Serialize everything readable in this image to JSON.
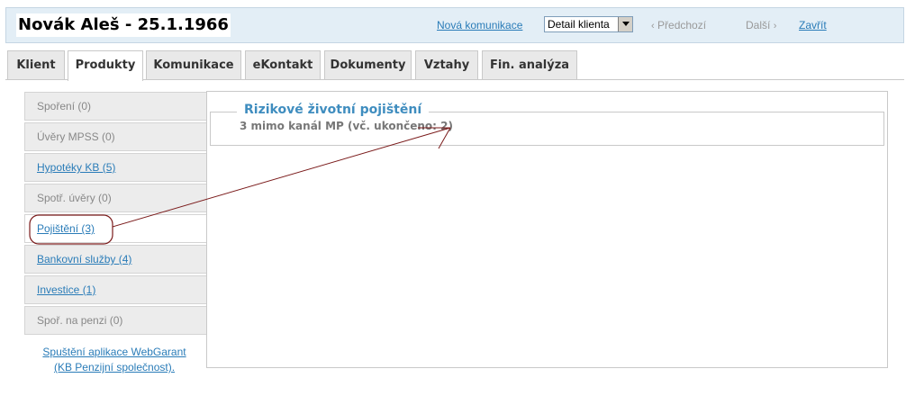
{
  "header": {
    "client_title": "Novák Aleš - 25.1.1966",
    "new_communication": "Nová komunikace",
    "detail_select": {
      "value": "Detail klienta"
    },
    "prev": "Předchozí",
    "next": "Další",
    "close": "Zavřít"
  },
  "tabs": [
    {
      "label": "Klient"
    },
    {
      "label": "Produkty"
    },
    {
      "label": "Komunikace"
    },
    {
      "label": "eKontakt"
    },
    {
      "label": "Dokumenty"
    },
    {
      "label": "Vztahy"
    },
    {
      "label": "Fin. analýza"
    }
  ],
  "active_tab": "Produkty",
  "sidebar": {
    "items": [
      {
        "label": "Spoření (0)",
        "link": false
      },
      {
        "label": "Úvěry MPSS (0)",
        "link": false
      },
      {
        "label": "Hypotéky KB (5)",
        "link": true
      },
      {
        "label": "Spotř. úvěry (0)",
        "link": false
      },
      {
        "label": "Pojištění (3)",
        "link": true,
        "active": true
      },
      {
        "label": "Bankovní služby (4)",
        "link": true
      },
      {
        "label": "Investice (1)",
        "link": true
      },
      {
        "label": "Spoř. na penzi (0)",
        "link": false
      }
    ],
    "footer_line1": "Spuštění aplikace WebGarant",
    "footer_line2": "(KB Penzijní společnost)."
  },
  "main": {
    "section_title": "Rizikové životní pojištění",
    "section_text": "3 mimo kanál MP (vč. ukončeno: 2)"
  },
  "colors": {
    "accent": "#3f8dbf",
    "link": "#2a7cb8",
    "annotation": "#7a1a1a",
    "header_bg": "#e3eef6"
  }
}
